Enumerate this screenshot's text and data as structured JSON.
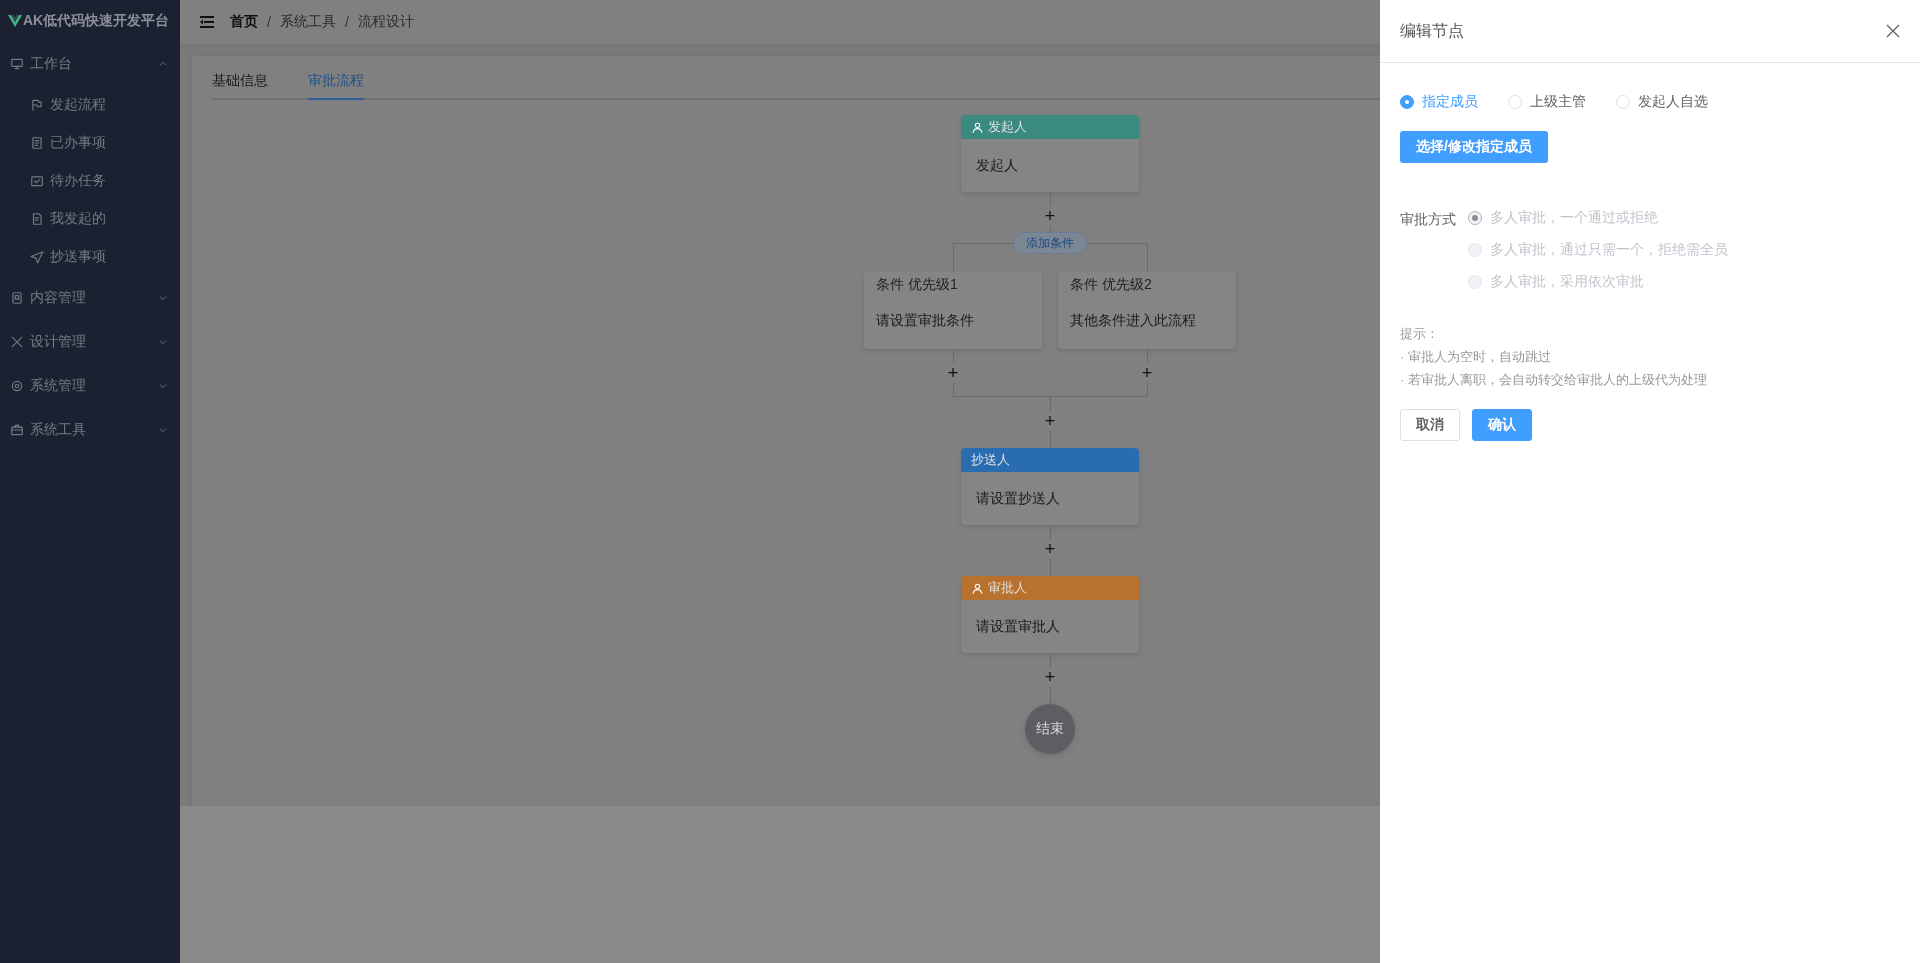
{
  "sidebar": {
    "logo": "AK低代码快速开发平台",
    "menu": [
      {
        "label": "工作台",
        "expanded": true,
        "children": [
          {
            "label": "发起流程"
          },
          {
            "label": "已办事项"
          },
          {
            "label": "待办任务"
          },
          {
            "label": "我发起的"
          },
          {
            "label": "抄送事项"
          }
        ]
      },
      {
        "label": "内容管理",
        "expanded": false
      },
      {
        "label": "设计管理",
        "expanded": false
      },
      {
        "label": "系统管理",
        "expanded": false
      },
      {
        "label": "系统工具",
        "expanded": false
      }
    ]
  },
  "header": {
    "separator": "/",
    "breadcrumb": [
      {
        "label": "首页",
        "link": true
      },
      {
        "label": "系统工具",
        "link": false
      },
      {
        "label": "流程设计",
        "link": false
      }
    ]
  },
  "tabs": [
    {
      "label": "基础信息",
      "selected": false
    },
    {
      "label": "审批流程",
      "selected": true
    }
  ],
  "flow": [
    {
      "kind": "node",
      "title": "发起人",
      "content": "发起人",
      "color": "#3a8a80",
      "user_icon": true
    },
    {
      "kind": "add",
      "label": "+"
    },
    {
      "kind": "branch",
      "button": "添加条件",
      "conditions": [
        {
          "title": "条件 优先级1",
          "content": "请设置审批条件",
          "add": "+"
        },
        {
          "title": "条件 优先级2",
          "content": "其他条件进入此流程",
          "add": "+"
        }
      ]
    },
    {
      "kind": "add",
      "label": "+"
    },
    {
      "kind": "node",
      "title": "抄送人",
      "content": "请设置抄送人",
      "color": "#2a6cb0",
      "user_icon": false
    },
    {
      "kind": "add",
      "label": "+"
    },
    {
      "kind": "node",
      "title": "审批人",
      "content": "请设置审批人",
      "color": "#b8712e",
      "user_icon": true
    },
    {
      "kind": "add",
      "label": "+"
    },
    {
      "kind": "end",
      "label": "结束"
    }
  ],
  "drawer": {
    "title": "编辑节点",
    "assignee_options": [
      {
        "label": "指定成员",
        "selected": true
      },
      {
        "label": "上级主管",
        "selected": false
      },
      {
        "label": "发起人自选",
        "selected": false
      }
    ],
    "select_button": "选择/修改指定成员",
    "mode": {
      "label": "审批方式",
      "options": [
        {
          "label": "多人审批，一个通过或拒绝",
          "selected": true,
          "disabled": true
        },
        {
          "label": "多人审批，通过只需一个，拒绝需全员",
          "selected": false,
          "disabled": true
        },
        {
          "label": "多人审批，采用依次审批",
          "selected": false,
          "disabled": true
        }
      ]
    },
    "tips": {
      "title": "提示：",
      "lines": [
        "· 审批人为空时，自动跳过",
        "· 若审批人离职，会自动转交给审批人的上级代为处理"
      ]
    },
    "buttons": [
      {
        "label": "取消",
        "kind": "default"
      },
      {
        "label": "确认",
        "kind": "primary"
      }
    ]
  }
}
